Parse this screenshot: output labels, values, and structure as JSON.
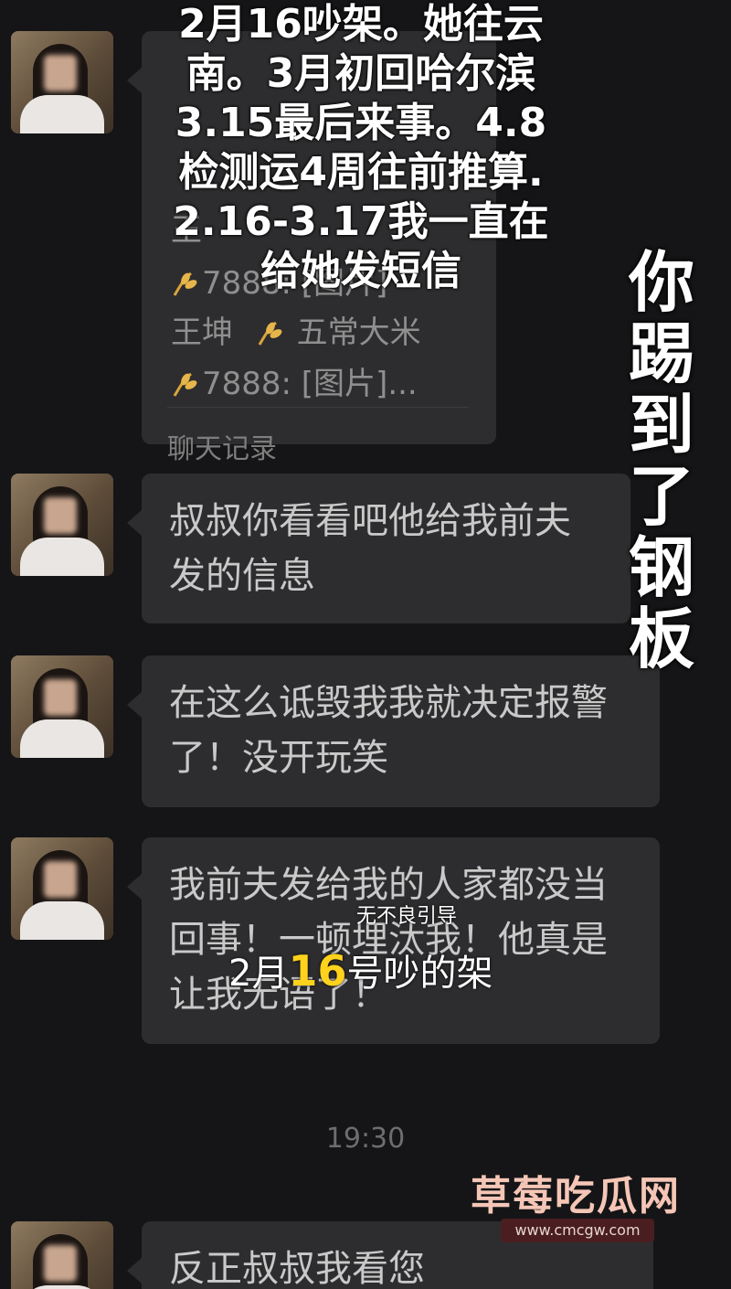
{
  "record_card": {
    "lines": [
      "王",
      "7888: [图片]",
      "王坤",
      "五常大米",
      "7888: [图片]..."
    ],
    "footer": "聊天记录"
  },
  "messages": [
    {
      "text": "叔叔你看看吧他给我前夫发的信息"
    },
    {
      "text": "在这么诋毁我我就决定报警了！没开玩笑"
    },
    {
      "text": "我前夫发给我的人家都没当回事！一顿埋汰我！他真是让我无语了！"
    },
    {
      "text": "反正叔叔我看您"
    }
  ],
  "timestamp": "19:30",
  "overlay_caption": {
    "lines": [
      "2月16吵架。她往云",
      "南。3月初回哈尔滨",
      "3.15最后来事。4.8",
      "检测运4周往前推算.",
      "2.16-3.17我一直在",
      "给她发短信"
    ]
  },
  "vertical_caption": [
    "你",
    "踢",
    "到",
    "了",
    "钢",
    "板"
  ],
  "subtitle": {
    "small": "无不良引导",
    "prefix": "2月",
    "highlight": "16",
    "suffix": "号吵的架"
  },
  "watermark": {
    "title": "草莓吃瓜网",
    "url": "www.cmcgw.com"
  },
  "colors": {
    "background": "#151517",
    "bubble": "#2d2d2f",
    "highlight": "#ffd21c"
  }
}
